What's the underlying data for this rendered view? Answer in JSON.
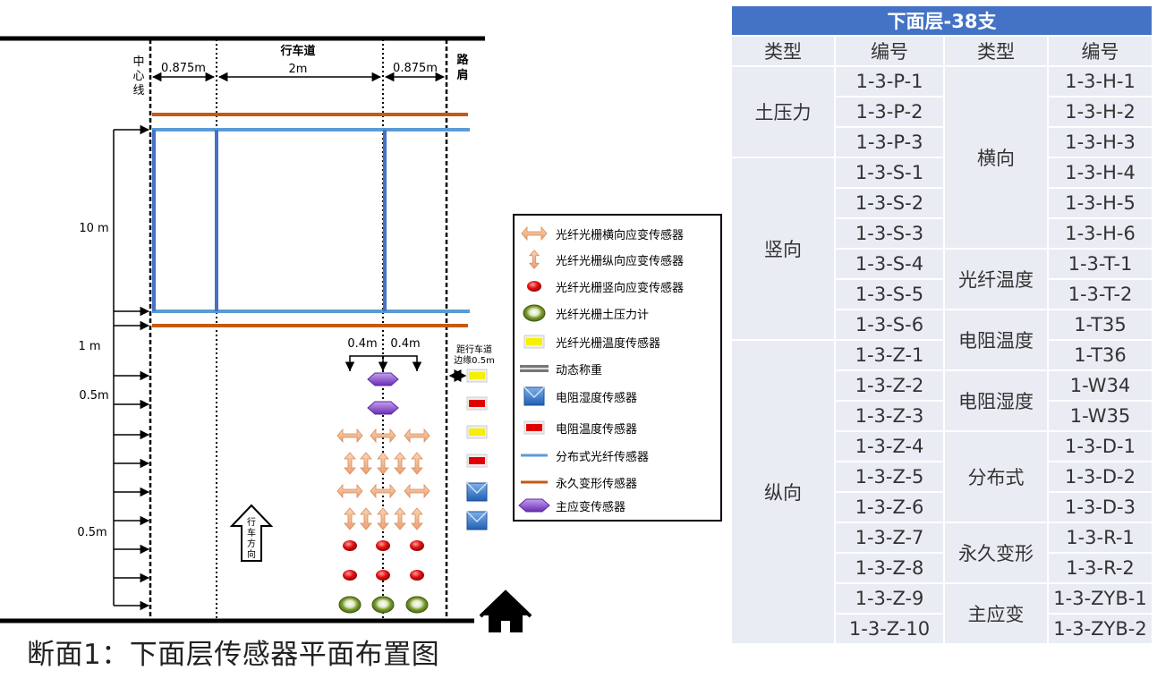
{
  "diagram": {
    "road_label": "行车道",
    "centerline_label": "中心线",
    "shoulder_label": "路肩",
    "dim_left": "0.875m",
    "dim_mid": "2m",
    "dim_right": "0.875m",
    "dim_10m": "10 m",
    "dim_1m": "1 m",
    "dim_05m_top": "0.5m",
    "dim_05m_bottom": "0.5m",
    "offset_left": "0.4m",
    "offset_right": "0.4m",
    "edge_note_line1": "距行车道",
    "edge_note_line2": "边缘0.5m",
    "direction_label": "行车方向",
    "caption": "断面1：下面层传感器平面布置图"
  },
  "legend": [
    {
      "icon": "horizontal-strain-arrow",
      "label": "光纤光栅横向应变传感器"
    },
    {
      "icon": "vertical-strain-arrow",
      "label": "光纤光栅纵向应变传感器"
    },
    {
      "icon": "red-dot",
      "label": "光纤光栅竖向应变传感器"
    },
    {
      "icon": "green-disc",
      "label": "光纤光栅土压力计"
    },
    {
      "icon": "yellow-block",
      "label": "光纤光栅温度传感器"
    },
    {
      "icon": "gray-bar",
      "label": "动态称重"
    },
    {
      "icon": "blue-block",
      "label": "电阻湿度传感器"
    },
    {
      "icon": "red-block",
      "label": "电阻温度传感器"
    },
    {
      "icon": "blue-line",
      "label": "分布式光纤传感器"
    },
    {
      "icon": "orange-line",
      "label": "永久变形传感器"
    },
    {
      "icon": "purple-hex",
      "label": "主应变传感器"
    }
  ],
  "colors": {
    "distributed_fiber": "#5b9bd5",
    "permanent_deformation": "#c55a11",
    "table_header": "#4472c4",
    "table_cell": "#e9ecf3"
  },
  "table": {
    "title": "下面层-38支",
    "headers": [
      "类型",
      "编号",
      "类型",
      "编号"
    ],
    "left_groups": [
      {
        "type": "土压力",
        "codes": [
          "1-3-P-1",
          "1-3-P-2",
          "1-3-P-3"
        ]
      },
      {
        "type": "竖向",
        "codes": [
          "1-3-S-1",
          "1-3-S-2",
          "1-3-S-3",
          "1-3-S-4",
          "1-3-S-5",
          "1-3-S-6"
        ]
      },
      {
        "type": "纵向",
        "codes": [
          "1-3-Z-1",
          "1-3-Z-2",
          "1-3-Z-3",
          "1-3-Z-4",
          "1-3-Z-5",
          "1-3-Z-6",
          "1-3-Z-7",
          "1-3-Z-8",
          "1-3-Z-9",
          "1-3-Z-10"
        ]
      }
    ],
    "right_groups": [
      {
        "type": "横向",
        "codes": [
          "1-3-H-1",
          "1-3-H-2",
          "1-3-H-3",
          "1-3-H-4",
          "1-3-H-5",
          "1-3-H-6"
        ]
      },
      {
        "type": "光纤温度",
        "codes": [
          "1-3-T-1",
          "1-3-T-2"
        ]
      },
      {
        "type": "电阻温度",
        "codes": [
          "1-T35",
          "1-T36"
        ]
      },
      {
        "type": "电阻湿度",
        "codes": [
          "1-W34",
          "1-W35"
        ]
      },
      {
        "type": "分布式",
        "codes": [
          "1-3-D-1",
          "1-3-D-2",
          "1-3-D-3"
        ]
      },
      {
        "type": "永久变形",
        "codes": [
          "1-3-R-1",
          "1-3-R-2"
        ]
      },
      {
        "type": "主应变",
        "codes": [
          "1-3-ZYB-1",
          "1-3-ZYB-2"
        ]
      }
    ]
  }
}
